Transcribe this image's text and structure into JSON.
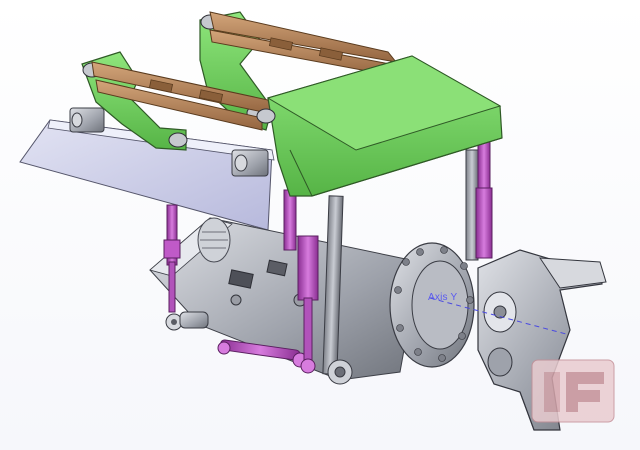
{
  "viewport": {
    "background": "#ffffff",
    "axis_label": "Axis Y"
  },
  "model": {
    "frame_color": "#7ddc6a",
    "link_color": "#b8875a",
    "cylinder_color": "#c05ac8",
    "steel_color": "#b9bcc4",
    "plate_color": "#c9cbe8",
    "axis_line_color": "#4a4ae0"
  },
  "logo": {
    "icon": "compass-logo-icon",
    "color": "#d3a4aa"
  }
}
